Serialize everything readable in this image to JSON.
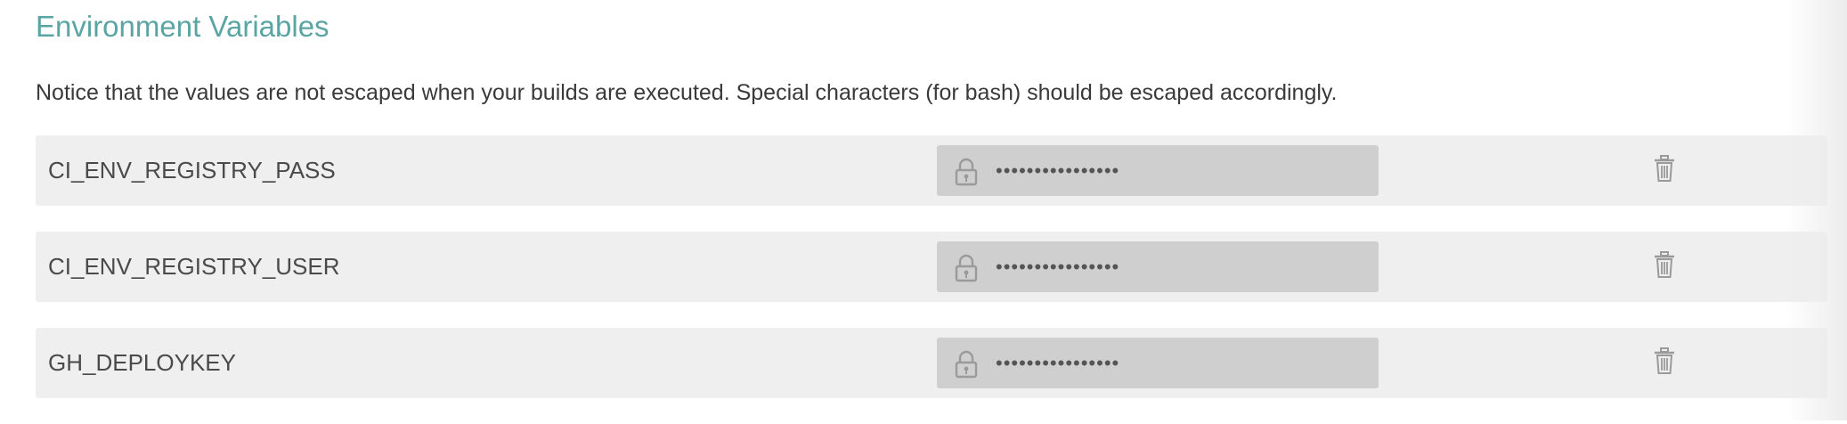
{
  "section": {
    "title": "Environment Variables",
    "notice": "Notice that the values are not escaped when your builds are executed. Special characters (for bash) should be escaped accordingly."
  },
  "variables": [
    {
      "name": "CI_ENV_REGISTRY_PASS",
      "value": "••••••••••••••••",
      "icon": "lock-icon",
      "action_icon": "trash-icon"
    },
    {
      "name": "CI_ENV_REGISTRY_USER",
      "value": "••••••••••••••••",
      "icon": "lock-icon",
      "action_icon": "trash-icon"
    },
    {
      "name": "GH_DEPLOYKEY",
      "value": "••••••••••••••••",
      "icon": "lock-icon",
      "action_icon": "trash-icon"
    }
  ],
  "colors": {
    "title": "#5aa5a3",
    "row_background": "#efefef",
    "value_background": "#cfcfcf",
    "text": "#4a4a4a",
    "icon": "#9a9a9a"
  }
}
